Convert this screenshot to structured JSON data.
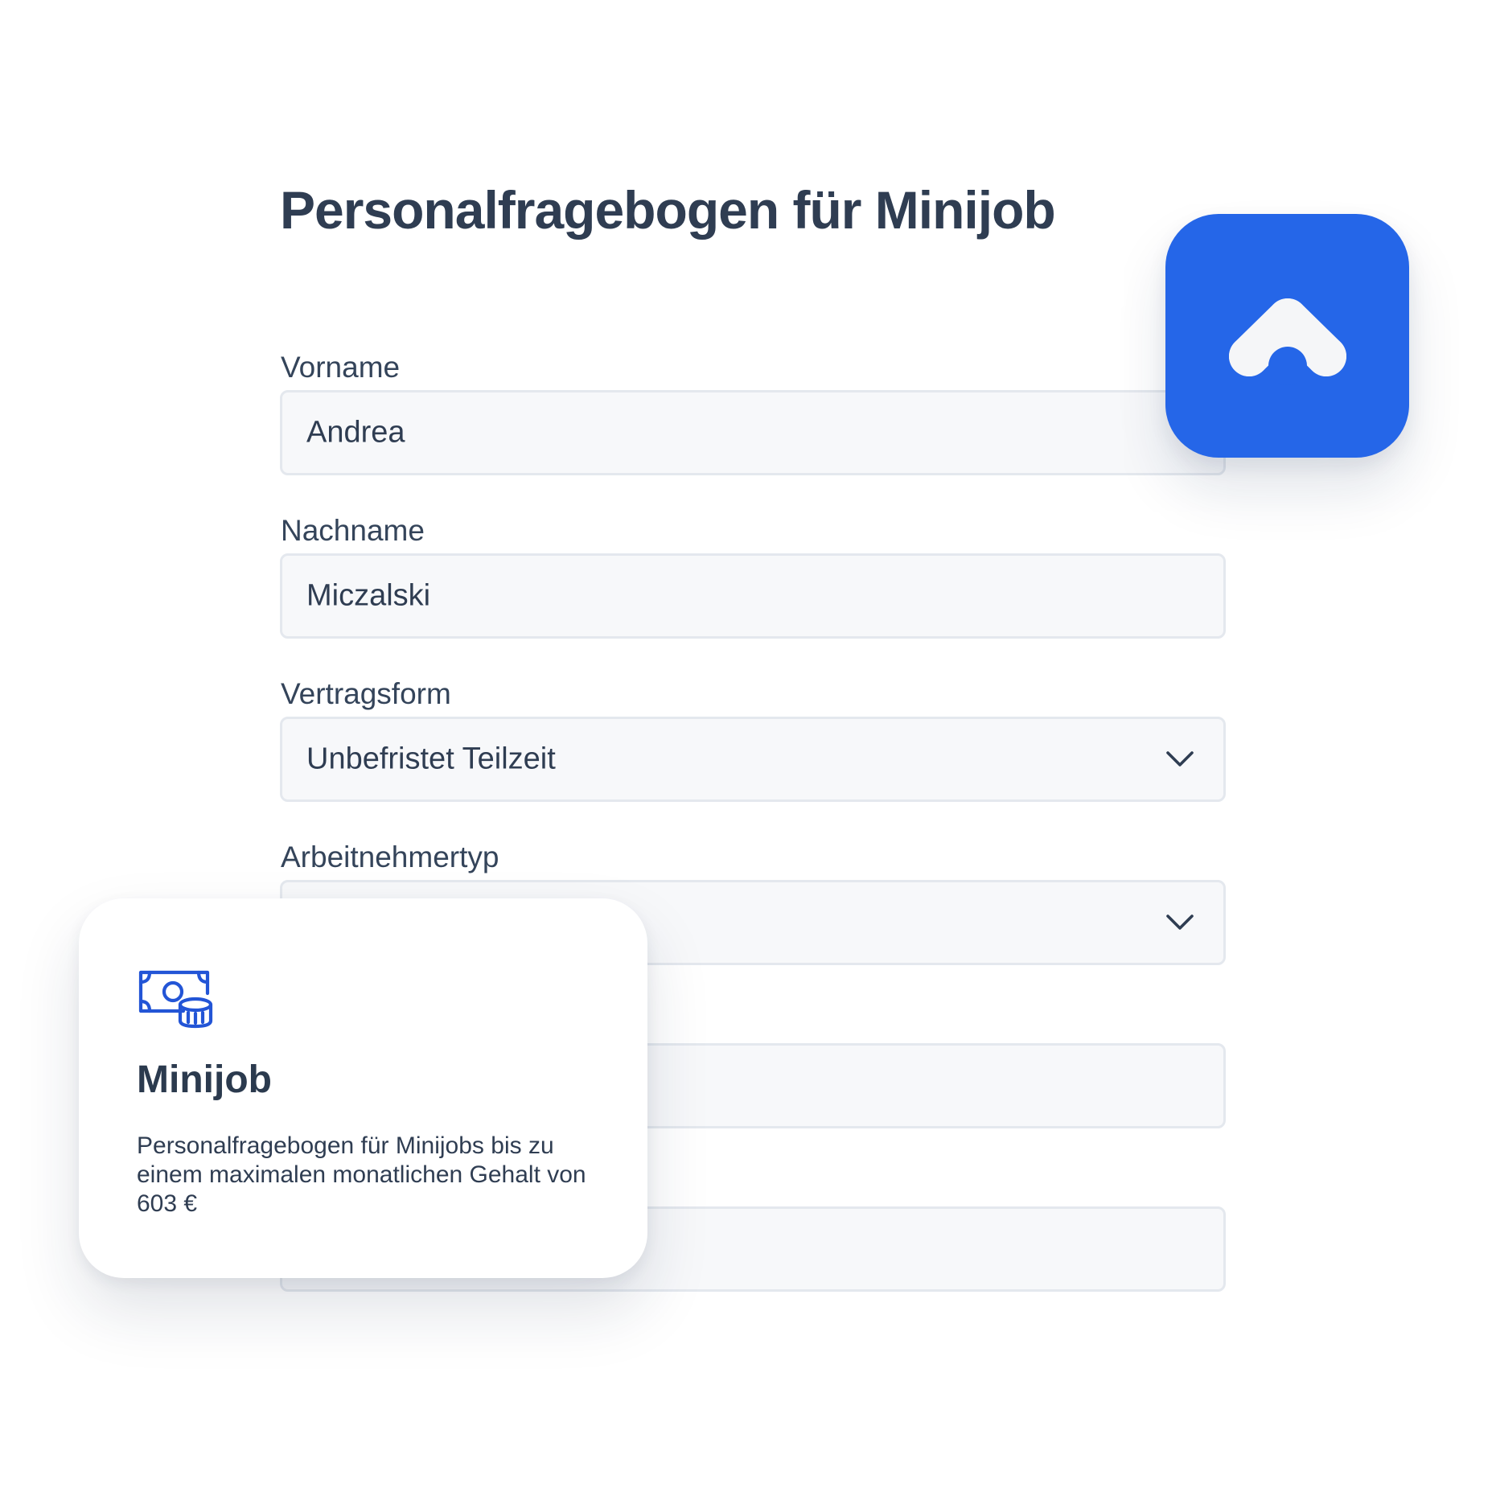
{
  "form": {
    "title": "Personalfragebogen für Minijob",
    "fields": [
      {
        "label": "Vorname",
        "value": "Andrea",
        "type": "text"
      },
      {
        "label": "Nachname",
        "value": "Miczalski",
        "type": "text"
      },
      {
        "label": "Vertragsform",
        "value": "Unbefristet Teilzeit",
        "type": "select"
      },
      {
        "label": "Arbeitnehmertyp",
        "value": "",
        "type": "select"
      },
      {
        "label": "",
        "value": "",
        "type": "text"
      },
      {
        "label": "",
        "value": "",
        "type": "text"
      }
    ]
  },
  "app_icon": {
    "icon": "app-logo-icon",
    "color": "#2566e8"
  },
  "card": {
    "icon": "money-coins-icon",
    "title": "Minijob",
    "description": "Personalfragebogen für Minijobs bis zu einem maximalen monatlichen Gehalt von 603 €",
    "accent_color": "#2355d6"
  }
}
